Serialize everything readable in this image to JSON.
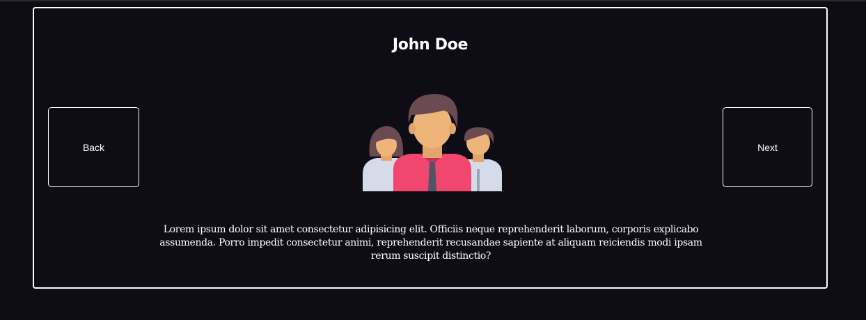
{
  "profile": {
    "name": "John Doe",
    "bio": "Lorem ipsum dolor sit amet consectetur adipisicing elit. Officiis neque reprehenderit laborum, corporis explicabo assumenda. Porro impedit consectetur animi, reprehenderit recusandae sapiente at aliquam reiciendis modi ipsam rerum suscipit distinctio?",
    "avatar_icon": "people-group-icon"
  },
  "nav": {
    "back_label": "Back",
    "next_label": "Next"
  },
  "colors": {
    "background": "#0e0d16",
    "border": "#ffffff",
    "text": "#ffffff",
    "shirt_main": "#f0466f",
    "skin": "#eeb57a",
    "hair": "#6b4b52",
    "shirt_side": "#d6dbea"
  }
}
